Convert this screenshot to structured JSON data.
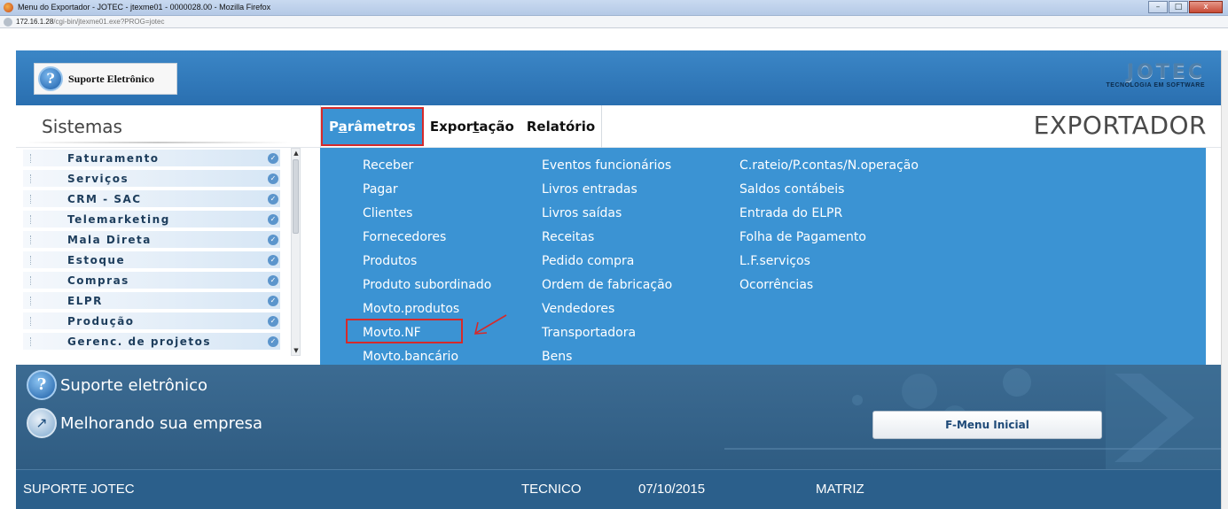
{
  "browser": {
    "window_title": "Menu do Exportador - JOTEC - jtexme01 - 0000028.00 - Mozilla Firefox",
    "url_host": "172.16.1.28",
    "url_path": "/cgi-bin/jtexme01.exe?PROG=jotec",
    "buttons": [
      "–",
      "□",
      "x"
    ]
  },
  "banner": {
    "support_label": "Suporte Eletrônico",
    "logo_text": "JOTEC",
    "logo_tagline": "TECNOLOGIA EM SOFTWARE"
  },
  "menubar": {
    "sistemas": "Sistemas",
    "tabs": [
      "Parâmetros",
      "Exportação",
      "Relatório"
    ],
    "active_tab": "Parâmetros",
    "module_title": "EXPORTADOR"
  },
  "sidebar": {
    "items": [
      "Faturamento",
      "Serviços",
      "CRM - SAC",
      "Telemarketing",
      "Mala Direta",
      "Estoque",
      "Compras",
      "ELPR",
      "Produção",
      "Gerenc. de projetos"
    ]
  },
  "menu": {
    "col1": [
      "Receber",
      "Pagar",
      "Clientes",
      "Fornecedores",
      "Produtos",
      "Produto subordinado",
      "Movto.produtos",
      "Movto.NF",
      "Movto.bancário"
    ],
    "col2": [
      "Eventos funcionários",
      "Livros entradas",
      "Livros saídas",
      "Receitas",
      "Pedido compra",
      "Ordem de fabricação",
      "Vendedores",
      "Transportadora",
      "Bens"
    ],
    "col3": [
      "C.rateio/P.contas/N.operação",
      "Saldos contábeis",
      "Entrada do ELPR",
      "Folha de Pagamento",
      "L.F.serviços",
      "Ocorrências"
    ],
    "highlighted_item": "Movto.NF"
  },
  "footer": {
    "support": "Suporte eletrônico",
    "improving": "Melhorando sua empresa",
    "fmenu_button": "F-Menu Inicial"
  },
  "status": {
    "company": "SUPORTE JOTEC",
    "user": "TECNICO",
    "date": "07/10/2015",
    "branch": "MATRIZ"
  },
  "colors": {
    "banner": "#2f78b9",
    "menu_panel": "#3b93d3",
    "highlight": "#d62a2a",
    "footer": "#34638a",
    "status": "#2b5f8b"
  }
}
